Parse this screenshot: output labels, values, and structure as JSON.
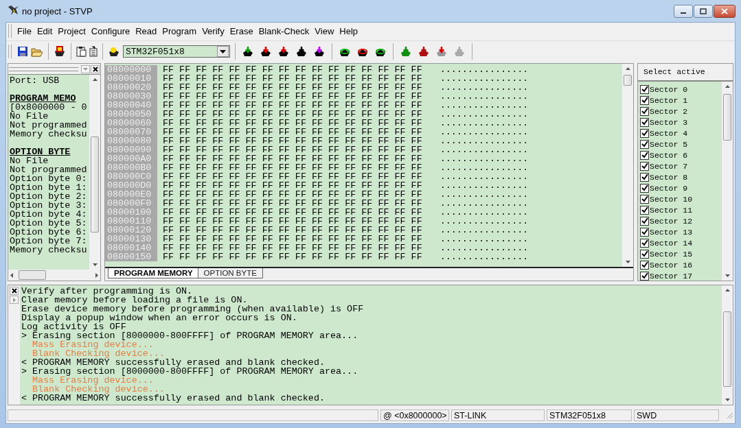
{
  "window": {
    "title": "no project - STVP"
  },
  "menu": [
    "File",
    "Edit",
    "Project",
    "Configure",
    "Read",
    "Program",
    "Verify",
    "Erase",
    "Blank-Check",
    "View",
    "Help"
  ],
  "device_select": {
    "value": "STM32F051x8"
  },
  "info_panel": {
    "lines": [
      {
        "kind": "text",
        "text": "Port: USB"
      },
      {
        "kind": "blank"
      },
      {
        "kind": "heading",
        "text": "PROGRAM MEMO"
      },
      {
        "kind": "text",
        "text": "[0x8000000 - 0"
      },
      {
        "kind": "text",
        "text": "No File"
      },
      {
        "kind": "text",
        "text": "Not programmed"
      },
      {
        "kind": "text",
        "text": "Memory checksu"
      },
      {
        "kind": "blank"
      },
      {
        "kind": "heading",
        "text": "OPTION BYTE"
      },
      {
        "kind": "text",
        "text": "No File"
      },
      {
        "kind": "text",
        "text": "Not programmed"
      },
      {
        "kind": "text",
        "text": "Option byte 0:"
      },
      {
        "kind": "text",
        "text": "Option byte 1:"
      },
      {
        "kind": "text",
        "text": "Option byte 2:"
      },
      {
        "kind": "text",
        "text": "Option byte 3:"
      },
      {
        "kind": "text",
        "text": "Option byte 4:"
      },
      {
        "kind": "text",
        "text": "Option byte 5:"
      },
      {
        "kind": "text",
        "text": "Option byte 6:"
      },
      {
        "kind": "text",
        "text": "Option byte 7:"
      },
      {
        "kind": "text",
        "text": "Memory checksu"
      }
    ]
  },
  "hex_view": {
    "rows": [
      {
        "address": "08000000",
        "bytes": "FF FF FF FF FF FF FF FF FF FF FF FF FF FF FF FF",
        "ascii": "................"
      },
      {
        "address": "08000010",
        "bytes": "FF FF FF FF FF FF FF FF FF FF FF FF FF FF FF FF",
        "ascii": "................"
      },
      {
        "address": "08000020",
        "bytes": "FF FF FF FF FF FF FF FF FF FF FF FF FF FF FF FF",
        "ascii": "................"
      },
      {
        "address": "08000030",
        "bytes": "FF FF FF FF FF FF FF FF FF FF FF FF FF FF FF FF",
        "ascii": "................"
      },
      {
        "address": "08000040",
        "bytes": "FF FF FF FF FF FF FF FF FF FF FF FF FF FF FF FF",
        "ascii": "................"
      },
      {
        "address": "08000050",
        "bytes": "FF FF FF FF FF FF FF FF FF FF FF FF FF FF FF FF",
        "ascii": "................"
      },
      {
        "address": "08000060",
        "bytes": "FF FF FF FF FF FF FF FF FF FF FF FF FF FF FF FF",
        "ascii": "................"
      },
      {
        "address": "08000070",
        "bytes": "FF FF FF FF FF FF FF FF FF FF FF FF FF FF FF FF",
        "ascii": "................"
      },
      {
        "address": "08000080",
        "bytes": "FF FF FF FF FF FF FF FF FF FF FF FF FF FF FF FF",
        "ascii": "................"
      },
      {
        "address": "08000090",
        "bytes": "FF FF FF FF FF FF FF FF FF FF FF FF FF FF FF FF",
        "ascii": "................"
      },
      {
        "address": "080000A0",
        "bytes": "FF FF FF FF FF FF FF FF FF FF FF FF FF FF FF FF",
        "ascii": "................"
      },
      {
        "address": "080000B0",
        "bytes": "FF FF FF FF FF FF FF FF FF FF FF FF FF FF FF FF",
        "ascii": "................"
      },
      {
        "address": "080000C0",
        "bytes": "FF FF FF FF FF FF FF FF FF FF FF FF FF FF FF FF",
        "ascii": "................"
      },
      {
        "address": "080000D0",
        "bytes": "FF FF FF FF FF FF FF FF FF FF FF FF FF FF FF FF",
        "ascii": "................"
      },
      {
        "address": "080000E0",
        "bytes": "FF FF FF FF FF FF FF FF FF FF FF FF FF FF FF FF",
        "ascii": "................"
      },
      {
        "address": "080000F0",
        "bytes": "FF FF FF FF FF FF FF FF FF FF FF FF FF FF FF FF",
        "ascii": "................"
      },
      {
        "address": "08000100",
        "bytes": "FF FF FF FF FF FF FF FF FF FF FF FF FF FF FF FF",
        "ascii": "................"
      },
      {
        "address": "08000110",
        "bytes": "FF FF FF FF FF FF FF FF FF FF FF FF FF FF FF FF",
        "ascii": "................"
      },
      {
        "address": "08000120",
        "bytes": "FF FF FF FF FF FF FF FF FF FF FF FF FF FF FF FF",
        "ascii": "................"
      },
      {
        "address": "08000130",
        "bytes": "FF FF FF FF FF FF FF FF FF FF FF FF FF FF FF FF",
        "ascii": "................"
      },
      {
        "address": "08000140",
        "bytes": "FF FF FF FF FF FF FF FF FF FF FF FF FF FF FF FF",
        "ascii": "................"
      },
      {
        "address": "08000150",
        "bytes": "FF FF FF FF FF FF FF FF FF FF FF FF FF FF FF FF",
        "ascii": "................"
      }
    ]
  },
  "tabs": [
    {
      "label": "PROGRAM MEMORY",
      "selected": true
    },
    {
      "label": "OPTION BYTE",
      "selected": false
    }
  ],
  "sectors": {
    "header": "Select active",
    "items": [
      {
        "label": "Sector 0",
        "checked": true
      },
      {
        "label": "Sector 1",
        "checked": true
      },
      {
        "label": "Sector 2",
        "checked": true
      },
      {
        "label": "Sector 3",
        "checked": true
      },
      {
        "label": "Sector 4",
        "checked": true
      },
      {
        "label": "Sector 5",
        "checked": true
      },
      {
        "label": "Sector 6",
        "checked": true
      },
      {
        "label": "Sector 7",
        "checked": true
      },
      {
        "label": "Sector 8",
        "checked": true
      },
      {
        "label": "Sector 9",
        "checked": true
      },
      {
        "label": "Sector 10",
        "checked": true
      },
      {
        "label": "Sector 11",
        "checked": true
      },
      {
        "label": "Sector 12",
        "checked": true
      },
      {
        "label": "Sector 13",
        "checked": true
      },
      {
        "label": "Sector 14",
        "checked": true
      },
      {
        "label": "Sector 15",
        "checked": true
      },
      {
        "label": "Sector 16",
        "checked": true
      },
      {
        "label": "Sector 17",
        "checked": true
      }
    ]
  },
  "log": [
    {
      "kind": "info",
      "text": "Verify after programming is ON."
    },
    {
      "kind": "info",
      "text": "Clear memory before loading a file is ON."
    },
    {
      "kind": "info",
      "text": "Erase device memory before programming (when available) is OFF"
    },
    {
      "kind": "info",
      "text": "Display a popup window when an error occurs is ON."
    },
    {
      "kind": "info",
      "text": "Log activity is OFF"
    },
    {
      "kind": "info",
      "text": "> Erasing section [8000000-800FFFF] of PROGRAM MEMORY area..."
    },
    {
      "kind": "progress",
      "text": "Mass Erasing device..."
    },
    {
      "kind": "progress",
      "text": "Blank Checking device..."
    },
    {
      "kind": "info",
      "text": "< PROGRAM MEMORY successfully erased and blank checked."
    },
    {
      "kind": "info",
      "text": "> Erasing section [8000000-800FFFF] of PROGRAM MEMORY area..."
    },
    {
      "kind": "progress",
      "text": "Mass Erasing device..."
    },
    {
      "kind": "progress",
      "text": "Blank Checking device..."
    },
    {
      "kind": "info",
      "text": "< PROGRAM MEMORY successfully erased and blank checked."
    }
  ],
  "status_bar": [
    "@ <0x8000000>",
    "ST-LINK",
    "STM32F051x8",
    "SWD"
  ]
}
